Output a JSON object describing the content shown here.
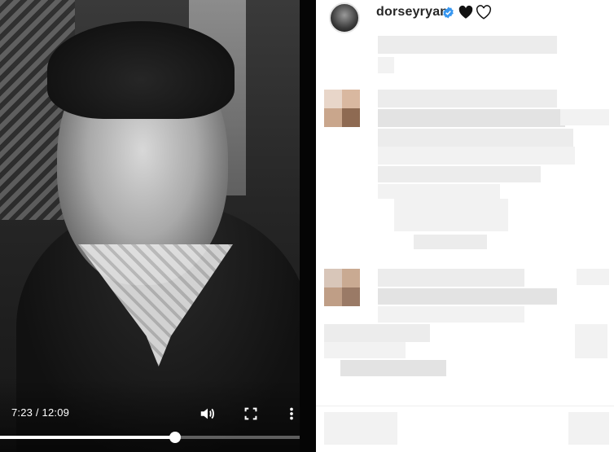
{
  "video": {
    "time_display": "7:23 / 12:09",
    "progress_fraction": 0.5833,
    "controls": {
      "volume_icon": "volume-icon",
      "fullscreen_icon": "fullscreen-icon",
      "more_icon": "more-vertical-icon"
    }
  },
  "post": {
    "username": "dorseyryan",
    "verified": true,
    "icons": [
      "verified-badge-icon",
      "black-heart-icon",
      "white-heart-icon"
    ]
  },
  "colors": {
    "verified_blue": "#3897f0",
    "text_primary": "#262626",
    "progress_fill": "#ffffff"
  }
}
